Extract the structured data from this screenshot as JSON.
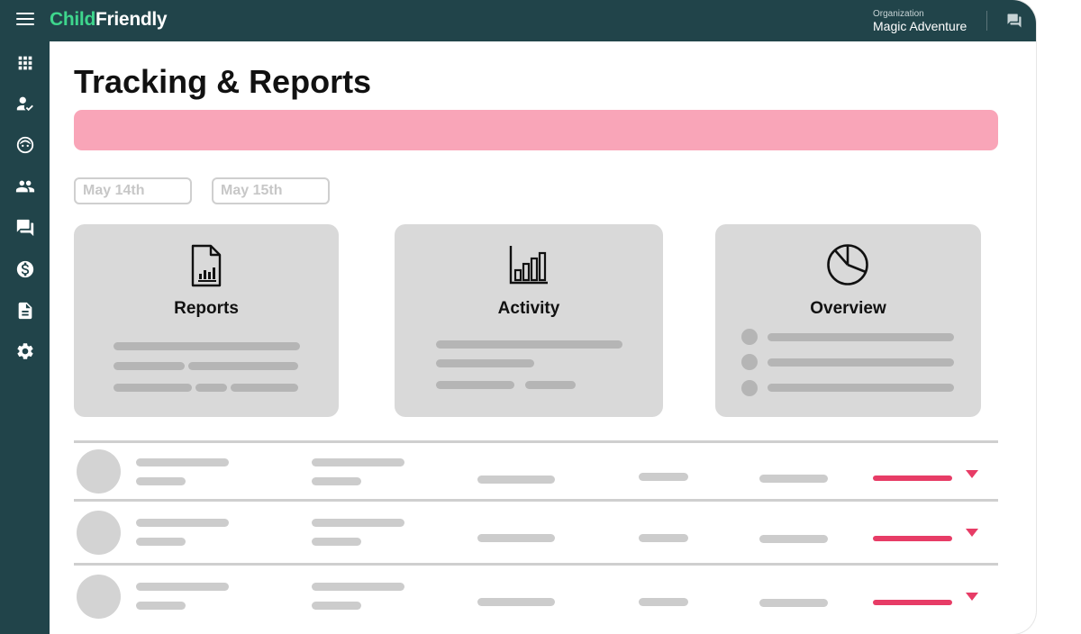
{
  "header": {
    "logo_part1": "Child",
    "logo_part2": "Friendly",
    "org_label": "Organization",
    "org_name": "Magic Adventure"
  },
  "sidebar": {
    "items": [
      {
        "icon": "grid-icon"
      },
      {
        "icon": "person-check-icon"
      },
      {
        "icon": "child-face-icon"
      },
      {
        "icon": "people-icon"
      },
      {
        "icon": "chat-icon"
      },
      {
        "icon": "dollar-icon"
      },
      {
        "icon": "document-icon"
      },
      {
        "icon": "gear-icon"
      }
    ]
  },
  "main": {
    "title": "Tracking & Reports",
    "date_from": {
      "placeholder": "May 14th"
    },
    "date_to": {
      "placeholder": "May 15th"
    },
    "cards": [
      {
        "title": "Reports",
        "icon": "report-document-icon"
      },
      {
        "title": "Activity",
        "icon": "bar-chart-icon"
      },
      {
        "title": "Overview",
        "icon": "pie-chart-icon"
      }
    ]
  },
  "colors": {
    "brand_dark": "#21444a",
    "brand_green": "#3ed68d",
    "banner_pink": "#f9a5b8",
    "accent_red": "#e73c66"
  }
}
